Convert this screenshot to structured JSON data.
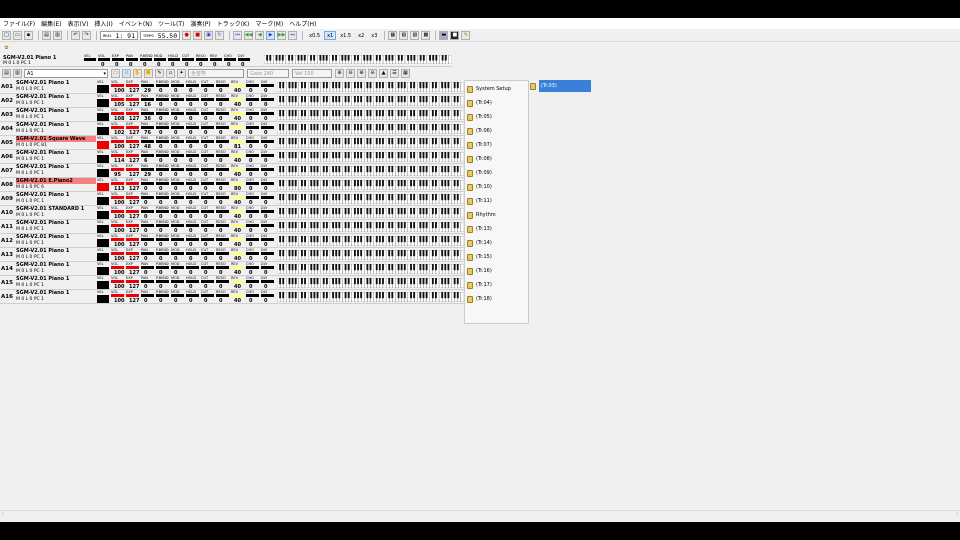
{
  "menu": [
    "ファイル(F)",
    "編集(E)",
    "表示(V)",
    "挿入(I)",
    "イベント(N)",
    "ツール(T)",
    "演奏(P)",
    "トラック(K)",
    "マーク(M)",
    "ヘルプ(H)"
  ],
  "transport": {
    "meas_label": "MEAS",
    "meas_value": "1:    91",
    "tempo_label": "TEMPO",
    "tempo_value": "55.50",
    "speeds": [
      "x0.5",
      "x1",
      "x1.5",
      "x2",
      "x3"
    ],
    "active_speed": "x1"
  },
  "master": {
    "name": "SGM-V2.01 Piano 1",
    "row2": "M    0    L    0  PC   1",
    "vel_label": "VEL",
    "vol_label": "VOL",
    "exp_label": "EXP",
    "pan_label": "PAN",
    "pbend_label": "P.BEND",
    "mod_label": "MOD",
    "hold_label": "HOLD",
    "cut_label": "CUT",
    "reso_label": "RESO",
    "rev_label": "REV",
    "cho_label": "CHO",
    "dly_label": "DLY",
    "values": [
      "0",
      "0",
      "0",
      "0",
      "0",
      "0",
      "0",
      "0",
      "0",
      "0",
      "0"
    ]
  },
  "toolbar3": {
    "combo_value": "A1",
    "filter_value": "全音符",
    "gate_label": "Gate",
    "gate_value": "240",
    "vel_label": "Vel",
    "vel_value": "100"
  },
  "ctl_labels": [
    "VOL",
    "EXP",
    "PAN",
    "P.BEND",
    "MOD",
    "HOLD",
    "CUT",
    "RESO",
    "REV",
    "CHO",
    "DLY"
  ],
  "tracks": [
    {
      "id": "A01",
      "name": "SGM-V2.01 Piano 1",
      "sub": "M    0    L    0  PC   1",
      "vol": "100",
      "exp": "127",
      "pan": "29",
      "rev": "40",
      "hl": false,
      "red": false
    },
    {
      "id": "A02",
      "name": "SGM-V2.01 Piano 1",
      "sub": "M    0    L    0  PC   1",
      "vol": "105",
      "exp": "127",
      "pan": "16",
      "rev": "40",
      "hl": false,
      "red": false
    },
    {
      "id": "A03",
      "name": "SGM-V2.01 Piano 1",
      "sub": "M    0    L    0  PC   1",
      "vol": "108",
      "exp": "127",
      "pan": "36",
      "rev": "40",
      "hl": false,
      "red": false
    },
    {
      "id": "A04",
      "name": "SGM-V2.01 Piano 1",
      "sub": "M    0    L    0  PC   1",
      "vol": "102",
      "exp": "127",
      "pan": "76",
      "rev": "40",
      "hl": false,
      "red": false
    },
    {
      "id": "A05",
      "name": "SGM-V2.01 Square Wave",
      "sub": "M    0    L    0  PC  81",
      "vol": "100",
      "exp": "127",
      "pan": "48",
      "rev": "81",
      "hl": true,
      "red": true
    },
    {
      "id": "A06",
      "name": "SGM-V2.01 Piano 1",
      "sub": "M    0    L    0  PC   1",
      "vol": "114",
      "exp": "127",
      "pan": "6",
      "rev": "40",
      "hl": false,
      "red": false
    },
    {
      "id": "A07",
      "name": "SGM-V2.01 Piano 1",
      "sub": "M    0    L    0  PC   1",
      "vol": "95",
      "exp": "127",
      "pan": "29",
      "rev": "40",
      "hl": false,
      "red": false
    },
    {
      "id": "A08",
      "name": "SGM-V2.01 E.Piano2",
      "sub": "M    0    L    0  PC   6",
      "vol": "113",
      "exp": "127",
      "pan": "0",
      "rev": "80",
      "hl": true,
      "red": true
    },
    {
      "id": "A09",
      "name": "SGM-V2.01 Piano 1",
      "sub": "M    0    L    0  PC   1",
      "vol": "100",
      "exp": "127",
      "pan": "0",
      "rev": "40",
      "hl": false,
      "red": false
    },
    {
      "id": "A10",
      "name": "SGM-V2.01 STANDARD 1",
      "sub": "M    0    L    0  PC   1",
      "vol": "100",
      "exp": "127",
      "pan": "0",
      "rev": "40",
      "hl": false,
      "red": false
    },
    {
      "id": "A11",
      "name": "SGM-V2.01 Piano 1",
      "sub": "M    0    L    0  PC   1",
      "vol": "100",
      "exp": "127",
      "pan": "0",
      "rev": "40",
      "hl": false,
      "red": false
    },
    {
      "id": "A12",
      "name": "SGM-V2.01 Piano 1",
      "sub": "M    0    L    0  PC   1",
      "vol": "100",
      "exp": "127",
      "pan": "0",
      "rev": "40",
      "hl": false,
      "red": false
    },
    {
      "id": "A13",
      "name": "SGM-V2.01 Piano 1",
      "sub": "M    0    L    0  PC   1",
      "vol": "100",
      "exp": "127",
      "pan": "0",
      "rev": "40",
      "hl": false,
      "red": false
    },
    {
      "id": "A14",
      "name": "SGM-V2.01 Piano 1",
      "sub": "M    0    L    0  PC   1",
      "vol": "100",
      "exp": "127",
      "pan": "0",
      "rev": "40",
      "hl": false,
      "red": false
    },
    {
      "id": "A15",
      "name": "SGM-V2.01 Piano 1",
      "sub": "M    0    L    0  PC   1",
      "vol": "100",
      "exp": "127",
      "pan": "0",
      "rev": "40",
      "hl": false,
      "red": false
    },
    {
      "id": "A16",
      "name": "SGM-V2.01 Piano 1",
      "sub": "M    0    L    0  PC   1",
      "vol": "100",
      "exp": "127",
      "pan": "0",
      "rev": "40",
      "hl": false,
      "red": false
    }
  ],
  "tracklist": [
    "System Setup",
    "(Tr.04)",
    "(Tr.05)",
    "(Tr.06)",
    "(Tr.07)",
    "(Tr.08)",
    "(Tr.09)",
    "(Tr.10)",
    "(Tr.11)",
    "Rhythm",
    "(Tr.13)",
    "(Tr.14)",
    "(Tr.15)",
    "(Tr.16)",
    "(Tr.17)",
    "(Tr.18)"
  ],
  "selected_track": "(Tr.03)",
  "colors": {
    "highlight": "#f48080",
    "selection": "#3a80d8",
    "meter_red": "#e00000"
  }
}
